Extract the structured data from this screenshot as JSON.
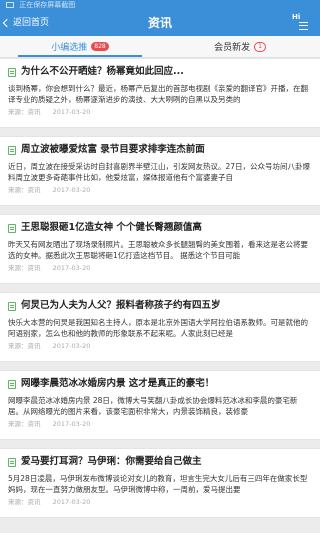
{
  "status_bar": {
    "text": "正在保存屏幕截图"
  },
  "header": {
    "back_label": "返回首页",
    "title": "资讯",
    "mode_label": "Hi"
  },
  "tabs": [
    {
      "label": "小编选推",
      "badge": "828"
    },
    {
      "label": "会员新发",
      "badge": "1"
    }
  ],
  "news": [
    {
      "title": "为什么不公开晒娃？杨幂竟如此回应...",
      "summary": "谈到杨幂，你会想到什么？最近，杨幂产后复出的首部电视剧《亲爱的翻译官》开播，在翻译专业的质疑之外，杨幂逐渐进步的演技、大大咧咧的自黑以及另类的",
      "source": "来源：资讯",
      "date": "2017-03-20"
    },
    {
      "title": "周立波被曝爱炫富 录节目要求排李连杰前面",
      "summary": "近日，周立波在接受采访时自封喜剧界半壁江山，引发网友热议。27日，公众号坊间八卦爆料周立波更多奇葩事件比如，他爱炫富，媒体报道他有个富婆妻子自",
      "source": "来源：资讯",
      "date": "2017-03-20"
    },
    {
      "title": "王思聪狠砸1亿造女神 个个健长臀翘颜值高",
      "summary": "昨天又有网友晒出了现场录制照片。王思聪被众多长腿翘臀的美女围着，看来这是老公将要选的女神。据悉此次王思聪将砸1亿打造这档节目。 据悉这个节目可能",
      "source": "来源：资讯",
      "date": "2017-03-20"
    },
    {
      "title": "何炅已为人夫为人父？报料者称孩子约有四五岁",
      "summary": "快乐大本营的何炅是我国知名主持人，原本是北京外国语大学阿拉伯语系教师。可是就他的阿语别家，怎么也和他的教师的形象联系不起来呢。人家此刻已经是",
      "source": "来源：资讯",
      "date": "2017-03-20"
    },
    {
      "title": "网曝李晨范冰冰婚房内景 这才是真正的豪宅！",
      "summary": "网曝李晨范冰冰婚房内景 28日，微博大号笑翻八卦成长协会爆料范冰冰和李晨的豪宅新居。从网络曝光的图片来看，该豪宅面积非常大，内景装饰精良，装修豪",
      "source": "来源：资讯",
      "date": "2017-03-20"
    },
    {
      "title": "爱马要打耳洞？马伊琍：你需要给自己做主",
      "summary": "5月28日凌晨，马伊琍发布微博谈论对女儿的教育，坦言生完大女儿后有三四年在做家长型妈妈，现在一直努力做朋友型。马伊琍微博中称，一周前，爱马提出要",
      "source": "来源：资讯",
      "date": "2017-03-20"
    }
  ]
}
